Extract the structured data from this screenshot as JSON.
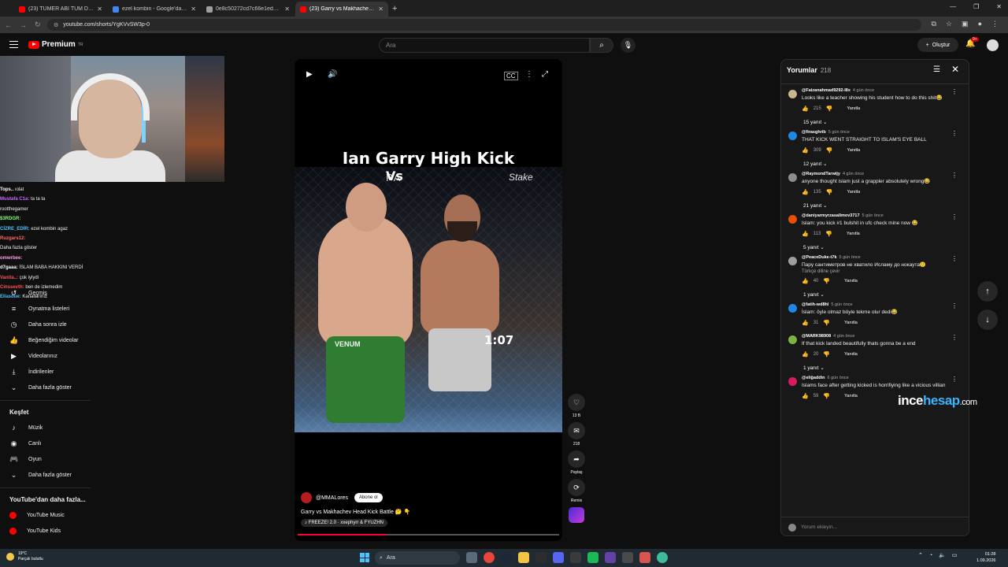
{
  "browser": {
    "tabs": [
      {
        "label": "(23) TÜMER ABİ TÜM DELİRME",
        "icon_color": "#ff0000",
        "active": false
      },
      {
        "label": "ezel kombin - Google'da Ara",
        "icon_color": "#4285f4",
        "active": false
      },
      {
        "label": "0e8c50272cd7c66e1ed6f6191",
        "icon_color": "#9e9e9e",
        "active": false
      },
      {
        "label": "(23) Garry vs Makhachev Head",
        "icon_color": "#ff0000",
        "active": true
      }
    ],
    "new_tab": "+",
    "url": "youtube.com/shorts/YgKVvSW3p-0"
  },
  "header": {
    "logo_text": "Premium",
    "logo_sup": "TR",
    "search_placeholder": "Ara",
    "create_label": "Oluştur",
    "notif_badge": "9+"
  },
  "chat": [
    {
      "user": "Tops..",
      "text": "ıolat",
      "color": "#ffffff"
    },
    {
      "user": "Mustafa C1a:",
      "text": "ta ta ta",
      "color": "#c86bff"
    },
    {
      "user": "",
      "text": "rootthegamer",
      "color": "#ffffff"
    },
    {
      "user": "$3RDGR:",
      "text": "",
      "color": "#7fff7f"
    },
    {
      "user": "CİZRE_EDİR:",
      "text": "ezel kombin agaz",
      "color": "#4fc3f7"
    },
    {
      "user": "Ruzgars12:",
      "text": "",
      "color": "#ff6b6b"
    },
    {
      "user": "",
      "text": "Daha fazla göster",
      "color": "#ffffff"
    },
    {
      "user": "omwrbee:",
      "text": "",
      "color": "#ff9ae6"
    },
    {
      "user": "d7gaaa:",
      "text": "İSLAM BABA HAKKINI VERDİ",
      "color": "#ffffff"
    },
    {
      "user": "Vanita..:",
      "text": "çok iyiydi",
      "color": "#ff5252"
    },
    {
      "user": "Cinssevth:",
      "text": "ben de izlemedim",
      "color": "#ff5252"
    },
    {
      "user": "Eliasdue:",
      "text": "Kanallarınız",
      "color": "#4fc3f7"
    }
  ],
  "sidebar": {
    "items": [
      {
        "icon": "history-icon",
        "glyph": "↺",
        "label": "Geçmiş"
      },
      {
        "icon": "playlist-icon",
        "glyph": "≡",
        "label": "Oynatma listeleri"
      },
      {
        "icon": "clock-icon",
        "glyph": "◷",
        "label": "Daha sonra izle"
      },
      {
        "icon": "thumbs-up-icon",
        "glyph": "👍",
        "label": "Beğendiğim videolar"
      },
      {
        "icon": "video-icon",
        "glyph": "▶",
        "label": "Videolarınız"
      },
      {
        "icon": "download-icon",
        "glyph": "⤓",
        "label": "İndirilenler"
      },
      {
        "icon": "chevron-down-icon",
        "glyph": "⌄",
        "label": "Daha fazla göster"
      }
    ],
    "explore_heading": "Keşfet",
    "explore_items": [
      {
        "icon": "music-icon",
        "glyph": "♪",
        "label": "Müzik"
      },
      {
        "icon": "live-icon",
        "glyph": "◉",
        "label": "Canlı"
      },
      {
        "icon": "gamepad-icon",
        "glyph": "🎮",
        "label": "Oyun"
      },
      {
        "icon": "chevron-down-icon",
        "glyph": "⌄",
        "label": "Daha fazla göster"
      }
    ],
    "more_heading": "YouTube'dan daha fazla...",
    "more_items": [
      {
        "label": "YouTube Music"
      },
      {
        "label": "YouTube Kids"
      }
    ]
  },
  "video": {
    "title_overlay": "Ian Garry High Kick",
    "vs_text": "Vs",
    "sponsor_left": "PA",
    "sponsor_right": "Stake",
    "timer": "1:07",
    "trunk_text": "VENUM",
    "channel": "@MMALores",
    "subscribe_label": "Abone ol",
    "description": "Garry vs Makhachev Head Kick Battle 🤔 👇",
    "music": "♪ FREEZE! 2.0 · xxephyrr & FYUZHN",
    "progress": 0.34
  },
  "actions": {
    "like_count": "13 B",
    "comment_count": "218",
    "share_label": "Paylaş",
    "remix_label": "Remix"
  },
  "comments": {
    "title": "Yorumlar",
    "count": "218",
    "input_placeholder": "Yorum ekleyin...",
    "items": [
      {
        "user": "@Faizanahmad9292-l8x",
        "time": "4 gün önce",
        "text": "Looks like a teacher showing his student  how to do this shit😂",
        "translate": "",
        "likes": "215",
        "reply": "Yanıtla",
        "replies": "15 yanıt",
        "av": "#c9b48e"
      },
      {
        "user": "@firasghrib",
        "time": "5 gün önce",
        "text": "THAT KICK WENT STRAIGHT TO ISLAM'S EYE BALL",
        "translate": "",
        "likes": "309",
        "reply": "Yanıtla",
        "replies": "12 yanıt",
        "av": "#1e88e5"
      },
      {
        "user": "@RaymondTarwijy",
        "time": "4 gün önce",
        "text": "anyone thought islam just a grappler absolutely wrong😂",
        "translate": "",
        "likes": "135",
        "reply": "Yanıtla",
        "replies": "21 yanıt",
        "av": "#8d8d8d"
      },
      {
        "user": "@daniyarmyrzasalimov3717",
        "time": "5 gün önce",
        "text": "Islam: you kick #1 bulshit in ufc check mine now 😂",
        "translate": "",
        "likes": "113",
        "reply": "Yanıtla",
        "replies": "5 yanıt",
        "av": "#e65100"
      },
      {
        "user": "@PeaceDuke-t7k",
        "time": "5 gün önce",
        "text": "Пару сантиметров не хватило Исламу до нокаута🙂",
        "translate": "Türkçe diline çevir",
        "likes": "40",
        "reply": "Yanıtla",
        "replies": "1 yanıt",
        "av": "#9e9e9e"
      },
      {
        "user": "@fatih-wd8hl",
        "time": "5 gün önce",
        "text": "İslam:  öyle olmaz böyle tekme olur dedi😂",
        "translate": "",
        "likes": "31",
        "reply": "Yanıtla",
        "replies": "",
        "av": "#1e88e5"
      },
      {
        "user": "@MARK98908",
        "time": "4 gün önce",
        "text": "If that kick landed beautifully thats gonna be a end",
        "translate": "",
        "likes": "20",
        "reply": "Yanıtla",
        "replies": "1 yanıt",
        "av": "#7cb342"
      },
      {
        "user": "@eliğaddin",
        "time": "6 gün önce",
        "text": "Islams face after getting kicked is horrifiying like a vicious villian",
        "translate": "",
        "likes": "59",
        "reply": "Yanıtla",
        "replies": "",
        "av": "#d81b60"
      }
    ]
  },
  "watermark": {
    "part1": "ince",
    "part2": "hesap",
    "part3": ".com"
  },
  "taskbar": {
    "weather_temp": "19°C",
    "weather_desc": "Parçalı bulutlu",
    "search_label": "Ara",
    "time": "01:28",
    "date": "1.09.2026"
  }
}
